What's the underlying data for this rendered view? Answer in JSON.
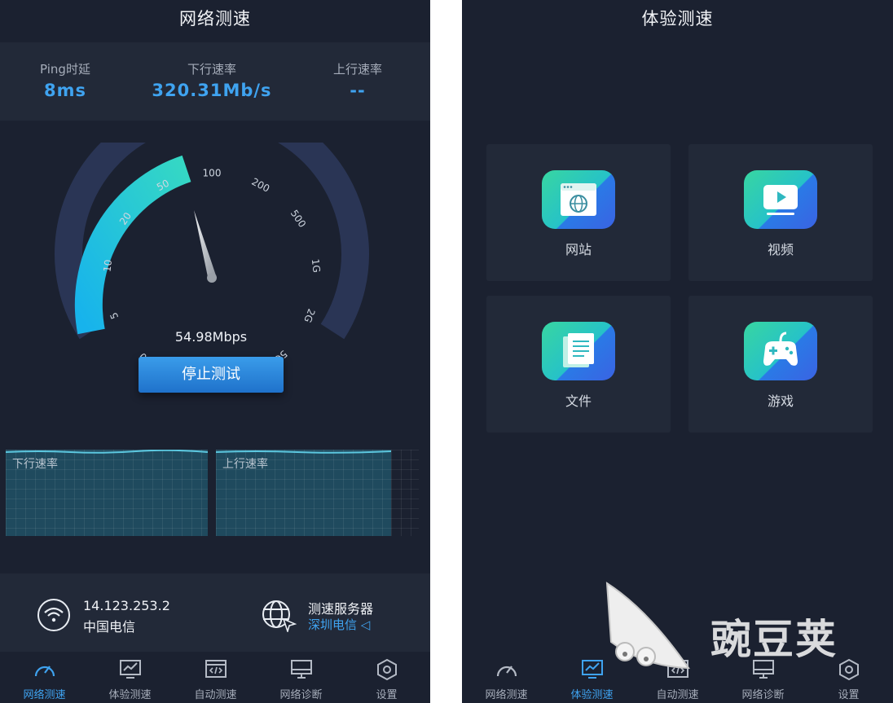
{
  "left": {
    "title": "网络测速",
    "stats": [
      {
        "label": "Ping时延",
        "value": "8ms"
      },
      {
        "label": "下行速率",
        "value": "320.31Mb/s"
      },
      {
        "label": "上行速率",
        "value": "--"
      }
    ],
    "gauge": {
      "ticks": [
        "0",
        "5",
        "10",
        "20",
        "50",
        "100",
        "200",
        "500",
        "1G",
        "2G",
        "5G"
      ],
      "needle_value": "100",
      "readout": "54.98Mbps"
    },
    "stop_button": "停止测试",
    "graphs": {
      "down_label": "下行速率",
      "up_label": "上行速率"
    },
    "info": {
      "ip": "14.123.253.2",
      "isp": "中国电信",
      "server_label": "测速服务器",
      "server_name": "深圳电信 ◁"
    }
  },
  "right": {
    "title": "体验测速",
    "cards": [
      {
        "label": "网站",
        "icon": "website-icon"
      },
      {
        "label": "视频",
        "icon": "video-icon"
      },
      {
        "label": "文件",
        "icon": "file-icon"
      },
      {
        "label": "游戏",
        "icon": "gamepad-icon"
      }
    ]
  },
  "tabs": [
    {
      "label": "网络测速",
      "icon": "speedometer-icon"
    },
    {
      "label": "体验测速",
      "icon": "monitor-chart-icon"
    },
    {
      "label": "自动测速",
      "icon": "code-window-icon"
    },
    {
      "label": "网络诊断",
      "icon": "desktop-icon"
    },
    {
      "label": "设置",
      "icon": "hexagon-settings-icon"
    }
  ],
  "left_active_tab": "网络测速",
  "right_active_tab": "体验测速",
  "watermark": "豌豆荚",
  "colors": {
    "background": "#1b2130",
    "panel": "#222938",
    "accent": "#3fa3f0",
    "gauge_active": "#2fd0c8"
  }
}
